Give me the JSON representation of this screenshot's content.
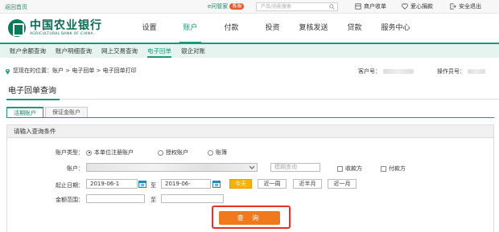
{
  "topbar": {
    "back": "返回首页",
    "emanager": "e问管家",
    "emanager_badge": "客服",
    "search_placeholder": "产品/功能搜索",
    "links": [
      "商户收单",
      "爱心捐款",
      "安全退出"
    ]
  },
  "logo": {
    "cn": "中国农业银行",
    "en": "AGRICULTURAL BANK OF CHINA"
  },
  "mainnav": [
    "设置",
    "账户",
    "付款",
    "投资",
    "复核发送",
    "贷款",
    "服务中心"
  ],
  "mainnav_active": 1,
  "subnav": [
    "账户余额查询",
    "账户明细查询",
    "网上交易查询",
    "电子回单",
    "银企对账"
  ],
  "subnav_active": 3,
  "breadcrumb": "您现在的位置：账户 > 电子回单 > 电子回单打印",
  "customer_label": "客户号：",
  "operator_label": "操作员号：",
  "page_title": "电子回单查询",
  "tabs": [
    "活期账户",
    "保证金账户"
  ],
  "panel_title": "请输入查询条件",
  "form": {
    "account_type_label": "账户类型：",
    "account_types": [
      "本单位注册账户",
      "授权账户",
      "账簿"
    ],
    "account_label": "账户：",
    "account_search_placeholder": "模糊查询",
    "checks": [
      "收款方",
      "付款方"
    ],
    "date_label": "起止日期：",
    "date_from": "2019-06-1",
    "date_to": "2019-06-",
    "to_sep": "至",
    "quick_buttons": [
      "今天",
      "近一周",
      "近半月",
      "近一月"
    ],
    "amount_label": "金额范围：",
    "submit": "查 询"
  },
  "colors": {
    "brand": "#1a9a78",
    "submit": "#f07a1b",
    "highlight": "#e53222",
    "today": "#f7b200"
  }
}
